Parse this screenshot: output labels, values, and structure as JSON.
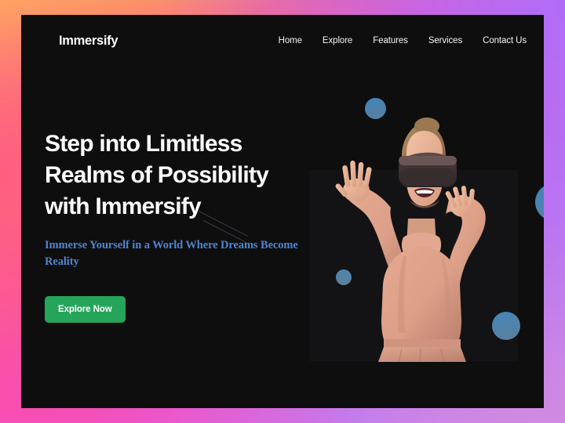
{
  "nav": {
    "brand": "Immersify",
    "links": [
      {
        "label": "Home"
      },
      {
        "label": "Explore"
      },
      {
        "label": "Features"
      },
      {
        "label": "Services"
      },
      {
        "label": "Contact Us"
      }
    ]
  },
  "hero": {
    "headline": "Step into Limitless Realms of Possibility with Immersify",
    "subheadline": "Immerse Yourself in a World Where Dreams Become Reality",
    "cta_label": "Explore Now"
  },
  "visual": {
    "alt": "woman-wearing-vr-headset",
    "bubbles": [
      {
        "name": "bubble-top"
      },
      {
        "name": "bubble-right"
      },
      {
        "name": "bubble-left"
      },
      {
        "name": "bubble-bottom"
      }
    ]
  },
  "colors": {
    "page_background": "#0e0e0f",
    "cta_green": "#25a55a",
    "subheadline_blue": "#4d85d1",
    "bubble_blue": "#3e87bd",
    "frame_yellow": "#fdcd53",
    "frame_pink": "#f356bb",
    "frame_purple": "#b06cf7",
    "frame_coral": "#ff5f7e"
  }
}
